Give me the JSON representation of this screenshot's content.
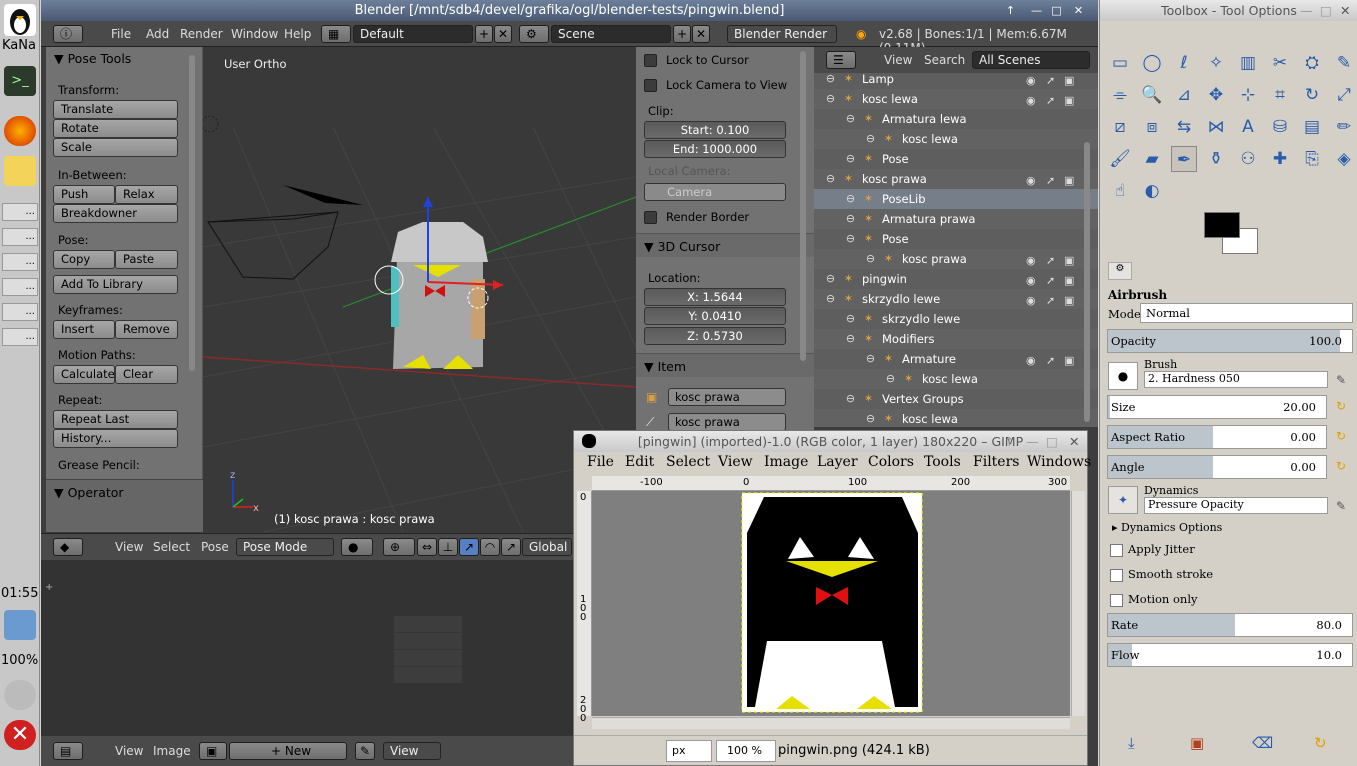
{
  "taskbar": {
    "user": "KaNa",
    "items": [
      "...",
      "...",
      "...",
      "...",
      "...",
      "..."
    ],
    "clock": "01:55",
    "battery": "100%"
  },
  "blender": {
    "title": "Blender [/mnt/sdb4/devel/grafika/ogl/blender-tests/pingwin.blend]",
    "menu": [
      "File",
      "Add",
      "Render",
      "Window",
      "Help"
    ],
    "layout": "Default",
    "scene": "Scene",
    "engine": "Blender Render",
    "stats": "v2.68 | Bones:1/1 | Mem:6.67M (0.11M)",
    "toolshelf": {
      "title": "Pose Tools",
      "transform": "Transform:",
      "translate": "Translate",
      "rotate": "Rotate",
      "scale": "Scale",
      "inbetween": "In-Between:",
      "push": "Push",
      "relax": "Relax",
      "breakdowner": "Breakdowner",
      "pose": "Pose:",
      "copy": "Copy",
      "paste": "Paste",
      "add_library": "Add To Library",
      "keyframes": "Keyframes:",
      "insert": "Insert",
      "remove": "Remove",
      "motion_paths": "Motion Paths:",
      "calculate": "Calculate",
      "clear": "Clear",
      "repeat": "Repeat:",
      "repeat_last": "Repeat Last",
      "history": "History...",
      "grease": "Grease Pencil:",
      "operator": "Operator"
    },
    "viewport": {
      "label": "User Ortho",
      "status": "(1) kosc prawa : kosc prawa"
    },
    "npanel": {
      "lock_cursor": "Lock to Cursor",
      "lock_camera": "Lock Camera to View",
      "clip": "Clip:",
      "start": "Start: 0.100",
      "end": "End: 1000.000",
      "local_camera": "Local Camera:",
      "camera": "Camera",
      "render_border": "Render Border",
      "cursor_head": "3D Cursor",
      "location": "Location:",
      "x": "X: 1.5644",
      "y": "Y: 0.0410",
      "z": "Z: 0.5730",
      "item_head": "Item",
      "item1": "kosc prawa",
      "item2": "kosc prawa"
    },
    "outliner": {
      "view": "View",
      "search": "Search",
      "filter": "All Scenes",
      "rows": [
        {
          "label": "Lamp",
          "indent": 0
        },
        {
          "label": "kosc lewa",
          "indent": 0
        },
        {
          "label": "Armatura lewa",
          "indent": 1
        },
        {
          "label": "kosc lewa",
          "indent": 2
        },
        {
          "label": "Pose",
          "indent": 1
        },
        {
          "label": "kosc prawa",
          "indent": 0
        },
        {
          "label": "PoseLib",
          "indent": 1
        },
        {
          "label": "Armatura prawa",
          "indent": 1
        },
        {
          "label": "Pose",
          "indent": 1
        },
        {
          "label": "kosc prawa",
          "indent": 2
        },
        {
          "label": "pingwin",
          "indent": 0
        },
        {
          "label": "skrzydlo lewe",
          "indent": 0
        },
        {
          "label": "skrzydlo lewe",
          "indent": 1
        },
        {
          "label": "Modifiers",
          "indent": 1
        },
        {
          "label": "Armature",
          "indent": 2
        },
        {
          "label": "kosc lewa",
          "indent": 3
        },
        {
          "label": "Vertex Groups",
          "indent": 1
        },
        {
          "label": "kosc lewa",
          "indent": 2
        }
      ]
    },
    "vp_header": {
      "view": "View",
      "select": "Select",
      "pose": "Pose",
      "mode": "Pose Mode",
      "orient": "Global"
    },
    "img_header": {
      "view": "View",
      "image": "Image",
      "new": "New",
      "view2": "View"
    }
  },
  "gimp_image": {
    "title": "[pingwin] (imported)-1.0 (RGB color, 1 layer) 180x220 – GIMP",
    "menu": [
      "File",
      "Edit",
      "Select",
      "View",
      "Image",
      "Layer",
      "Colors",
      "Tools",
      "Filters",
      "Windows"
    ],
    "ruler": [
      "-100",
      "0",
      "100",
      "200",
      "300"
    ],
    "ruler_v": [
      "0",
      "100",
      "200"
    ],
    "unit": "px",
    "zoom": "100 %",
    "file": "pingwin.png (424.1 kB)"
  },
  "toolbox": {
    "title": "Toolbox - Tool Options",
    "tool": "Airbrush",
    "mode_label": "Mode:",
    "mode": "Normal",
    "opacity": {
      "label": "Opacity",
      "value": "100.0"
    },
    "brush_label": "Brush",
    "brush": "2. Hardness 050",
    "size": {
      "label": "Size",
      "value": "20.00"
    },
    "aspect": {
      "label": "Aspect Ratio",
      "value": "0.00"
    },
    "angle": {
      "label": "Angle",
      "value": "0.00"
    },
    "dyn_label": "Dynamics",
    "dynamics": "Pressure Opacity",
    "dyn_options": "Dynamics Options",
    "jitter": "Apply Jitter",
    "smooth": "Smooth stroke",
    "motion": "Motion only",
    "rate": {
      "label": "Rate",
      "value": "80.0"
    },
    "flow": {
      "label": "Flow",
      "value": "10.0"
    },
    "fg_color": "#000000",
    "bg_color": "#ffffff"
  }
}
